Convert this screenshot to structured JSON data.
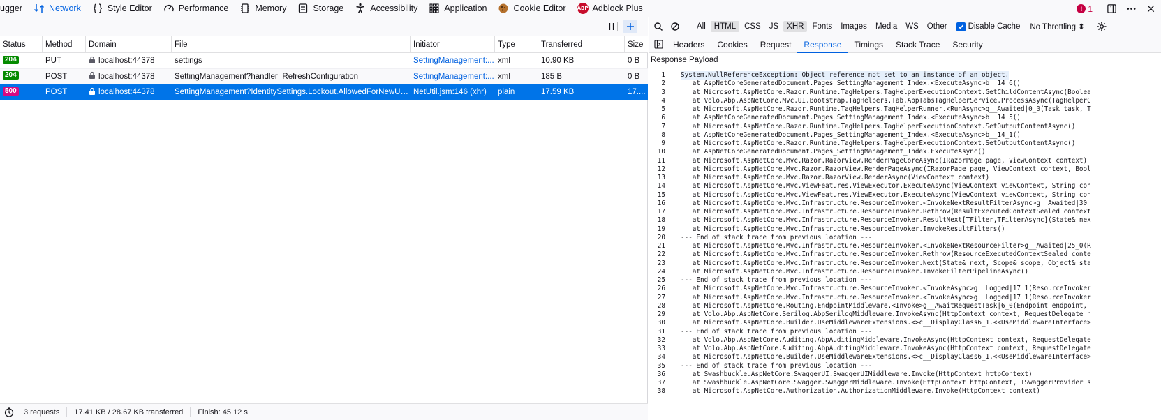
{
  "toolbar": {
    "tabs": [
      {
        "label": "ugger",
        "icon": "debugger-icon"
      },
      {
        "label": "Network",
        "icon": "network-icon"
      },
      {
        "label": "Style Editor",
        "icon": "braces-icon"
      },
      {
        "label": "Performance",
        "icon": "gauge-icon"
      },
      {
        "label": "Memory",
        "icon": "chip-icon"
      },
      {
        "label": "Storage",
        "icon": "storage-icon"
      },
      {
        "label": "Accessibility",
        "icon": "accessibility-icon"
      },
      {
        "label": "Application",
        "icon": "grid-icon"
      },
      {
        "label": "Cookie Editor",
        "icon": "cookie-icon"
      },
      {
        "label": "Adblock Plus",
        "icon": "abp-icon",
        "badge": "ABP"
      }
    ],
    "error_count": "1"
  },
  "columns": {
    "status": "Status",
    "method": "Method",
    "domain": "Domain",
    "file": "File",
    "initiator": "Initiator",
    "type": "Type",
    "transferred": "Transferred",
    "size": "Size"
  },
  "requests": [
    {
      "status": "204",
      "method": "PUT",
      "domain": "localhost:44378",
      "file": "settings",
      "initiator": "SettingManagement:...",
      "type": "xml",
      "transferred": "10.90 KB",
      "size": "0 B"
    },
    {
      "status": "204",
      "method": "POST",
      "domain": "localhost:44378",
      "file": "SettingManagement?handler=RefreshConfiguration",
      "initiator": "SettingManagement:...",
      "type": "xml",
      "transferred": "185 B",
      "size": "0 B"
    },
    {
      "status": "500",
      "method": "POST",
      "domain": "localhost:44378",
      "file": "SettingManagement?IdentitySettings.Lockout.AllowedForNewUsers=true",
      "initiator": "NetUtil.jsm:146 (xhr)",
      "type": "plain",
      "transferred": "17.59 KB",
      "size": "17...."
    }
  ],
  "footer": {
    "requests": "3 requests",
    "transferred": "17.41 KB / 28.67 KB transferred",
    "finish": "Finish: 45.12 s"
  },
  "type_filters": [
    "All",
    "HTML",
    "CSS",
    "JS",
    "XHR",
    "Fonts",
    "Images",
    "Media",
    "WS",
    "Other"
  ],
  "type_filters_active": [
    "HTML",
    "XHR"
  ],
  "disable_cache": "Disable Cache",
  "throttling": "No Throttling ⬍",
  "detail_tabs": [
    "Headers",
    "Cookies",
    "Request",
    "Response",
    "Timings",
    "Stack Trace",
    "Security"
  ],
  "detail_tab_active": "Response",
  "payload_title": "Response Payload",
  "code_lines": [
    "System.NullReferenceException: Object reference not set to an instance of an object.",
    "   at AspNetCoreGeneratedDocument.Pages_SettingManagement_Index.<ExecuteAsync>b__14_6()",
    "   at Microsoft.AspNetCore.Razor.Runtime.TagHelpers.TagHelperExecutionContext.GetChildContentAsync(Boolea",
    "   at Volo.Abp.AspNetCore.Mvc.UI.Bootstrap.TagHelpers.Tab.AbpTabsTagHelperService.ProcessAsync(TagHelperC",
    "   at Microsoft.AspNetCore.Razor.Runtime.TagHelpers.TagHelperRunner.<RunAsync>g__Awaited|0_0(Task task, T",
    "   at AspNetCoreGeneratedDocument.Pages_SettingManagement_Index.<ExecuteAsync>b__14_5()",
    "   at Microsoft.AspNetCore.Razor.Runtime.TagHelpers.TagHelperExecutionContext.SetOutputContentAsync()",
    "   at AspNetCoreGeneratedDocument.Pages_SettingManagement_Index.<ExecuteAsync>b__14_1()",
    "   at Microsoft.AspNetCore.Razor.Runtime.TagHelpers.TagHelperExecutionContext.SetOutputContentAsync()",
    "   at AspNetCoreGeneratedDocument.Pages_SettingManagement_Index.ExecuteAsync()",
    "   at Microsoft.AspNetCore.Mvc.Razor.RazorView.RenderPageCoreAsync(IRazorPage page, ViewContext context)",
    "   at Microsoft.AspNetCore.Mvc.Razor.RazorView.RenderPageAsync(IRazorPage page, ViewContext context, Bool",
    "   at Microsoft.AspNetCore.Mvc.Razor.RazorView.RenderAsync(ViewContext context)",
    "   at Microsoft.AspNetCore.Mvc.ViewFeatures.ViewExecutor.ExecuteAsync(ViewContext viewContext, String con",
    "   at Microsoft.AspNetCore.Mvc.ViewFeatures.ViewExecutor.ExecuteAsync(ViewContext viewContext, String con",
    "   at Microsoft.AspNetCore.Mvc.Infrastructure.ResourceInvoker.<InvokeNextResultFilterAsync>g__Awaited|30_",
    "   at Microsoft.AspNetCore.Mvc.Infrastructure.ResourceInvoker.Rethrow(ResultExecutedContextSealed context",
    "   at Microsoft.AspNetCore.Mvc.Infrastructure.ResourceInvoker.ResultNext[TFilter,TFilterAsync](State& nex",
    "   at Microsoft.AspNetCore.Mvc.Infrastructure.ResourceInvoker.InvokeResultFilters()",
    "--- End of stack trace from previous location ---",
    "   at Microsoft.AspNetCore.Mvc.Infrastructure.ResourceInvoker.<InvokeNextResourceFilter>g__Awaited|25_0(R",
    "   at Microsoft.AspNetCore.Mvc.Infrastructure.ResourceInvoker.Rethrow(ResourceExecutedContextSealed conte",
    "   at Microsoft.AspNetCore.Mvc.Infrastructure.ResourceInvoker.Next(State& next, Scope& scope, Object& sta",
    "   at Microsoft.AspNetCore.Mvc.Infrastructure.ResourceInvoker.InvokeFilterPipelineAsync()",
    "--- End of stack trace from previous location ---",
    "   at Microsoft.AspNetCore.Mvc.Infrastructure.ResourceInvoker.<InvokeAsync>g__Logged|17_1(ResourceInvoker",
    "   at Microsoft.AspNetCore.Mvc.Infrastructure.ResourceInvoker.<InvokeAsync>g__Logged|17_1(ResourceInvoker",
    "   at Microsoft.AspNetCore.Routing.EndpointMiddleware.<Invoke>g__AwaitRequestTask|6_0(Endpoint endpoint,",
    "   at Volo.Abp.AspNetCore.Serilog.AbpSerilogMiddleware.InvokeAsync(HttpContext context, RequestDelegate n",
    "   at Microsoft.AspNetCore.Builder.UseMiddlewareExtensions.<>c__DisplayClass6_1.<<UseMiddlewareInterface>",
    "--- End of stack trace from previous location ---",
    "   at Volo.Abp.AspNetCore.Auditing.AbpAuditingMiddleware.InvokeAsync(HttpContext context, RequestDelegate",
    "   at Volo.Abp.AspNetCore.Auditing.AbpAuditingMiddleware.InvokeAsync(HttpContext context, RequestDelegate",
    "   at Microsoft.AspNetCore.Builder.UseMiddlewareExtensions.<>c__DisplayClass6_1.<<UseMiddlewareInterface>",
    "--- End of stack trace from previous location ---",
    "   at Swashbuckle.AspNetCore.SwaggerUI.SwaggerUIMiddleware.Invoke(HttpContext httpContext)",
    "   at Swashbuckle.AspNetCore.Swagger.SwaggerMiddleware.Invoke(HttpContext httpContext, ISwaggerProvider s",
    "   at Microsoft.AspNetCore.Authorization.AuthorizationMiddleware.Invoke(HttpContext context)"
  ]
}
